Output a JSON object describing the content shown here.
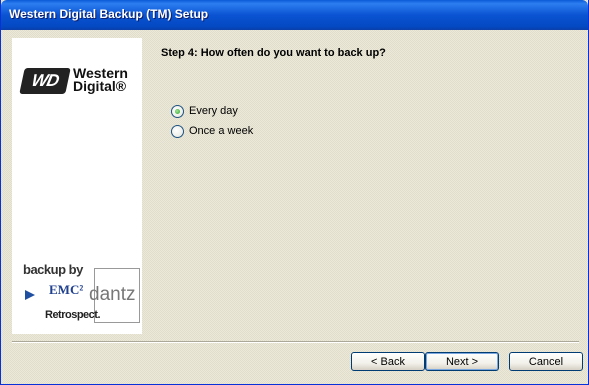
{
  "window": {
    "title": "Western Digital Backup (TM) Setup"
  },
  "sidebar": {
    "wd_logo": {
      "badge": "WD",
      "line1": "Western",
      "line2": "Digital®"
    },
    "backup_logo": {
      "backup_by": "backup by",
      "emc": "EMC²",
      "dantz": "dantz",
      "retrospect": "Retrospect."
    }
  },
  "main": {
    "step_title": "Step 4: How often do you want to back up?",
    "options": [
      {
        "label": "Every day",
        "checked": true
      },
      {
        "label": "Once a week",
        "checked": false
      }
    ]
  },
  "buttons": {
    "back": "< Back",
    "next": "Next >",
    "cancel": "Cancel"
  }
}
